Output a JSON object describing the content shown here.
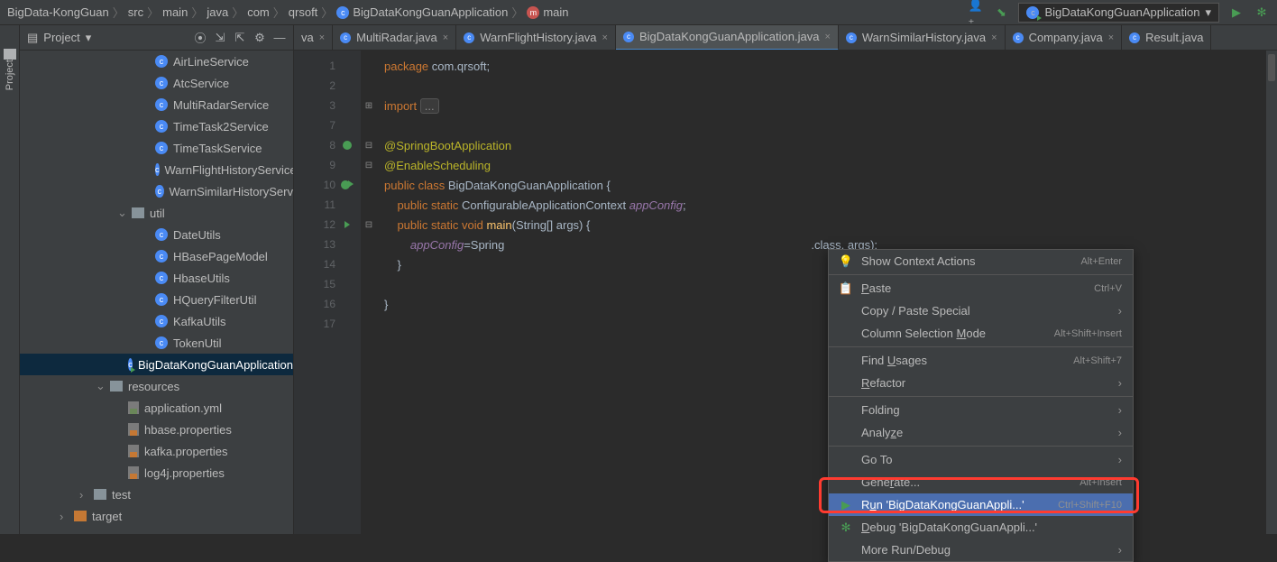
{
  "breadcrumbs": [
    "BigData-KongGuan",
    "src",
    "main",
    "java",
    "com",
    "qrsoft",
    "BigDataKongGuanApplication",
    "main"
  ],
  "run_config": "BigDataKongGuanApplication",
  "leftrail": "Project",
  "projpanel_title": "Project",
  "tree": {
    "services": [
      "AirLineService",
      "AtcService",
      "MultiRadarService",
      "TimeTask2Service",
      "TimeTaskService",
      "WarnFlightHistoryService",
      "WarnSimilarHistoryServ"
    ],
    "util_label": "util",
    "utils": [
      "DateUtils",
      "HBasePageModel",
      "HbaseUtils",
      "HQueryFilterUtil",
      "KafkaUtils",
      "TokenUtil"
    ],
    "app_class": "BigDataKongGuanApplication",
    "resources_label": "resources",
    "resources": [
      "application.yml",
      "hbase.properties",
      "kafka.properties",
      "log4j.properties"
    ],
    "test_label": "test",
    "target_label": "target"
  },
  "tabs": [
    {
      "label": "va",
      "active": false,
      "partial": true
    },
    {
      "label": "MultiRadar.java",
      "active": false
    },
    {
      "label": "WarnFlightHistory.java",
      "active": false
    },
    {
      "label": "BigDataKongGuanApplication.java",
      "active": true
    },
    {
      "label": "WarnSimilarHistory.java",
      "active": false
    },
    {
      "label": "Company.java",
      "active": false
    },
    {
      "label": "Result.java",
      "active": false,
      "noclose": true
    }
  ],
  "line_numbers": [
    "1",
    "2",
    "3",
    "7",
    "8",
    "9",
    "10",
    "11",
    "12",
    "13",
    "14",
    "15",
    "16",
    "17"
  ],
  "code": {
    "l1_kw": "package ",
    "l1_rest": "com.qrsoft;",
    "l3_kw": "import ",
    "l3_fold": "...",
    "l5": "@SpringBootApplication",
    "l6": "@EnableScheduling",
    "l7_kw": "public class ",
    "l7_name": "BigDataKongGuanApplication ",
    "l7_brace": "{",
    "l8_indent": "    ",
    "l8_kw": "public static ",
    "l8_type": "ConfigurableApplicationContext ",
    "l8_field": "appConfig",
    "l8_semi": ";",
    "l9_indent": "    ",
    "l9_kw": "public static void ",
    "l9_fn": "main",
    "l9_args": "(String[] args) {",
    "l10_indent": "        ",
    "l10_field": "appConfig",
    "l10_eq": "=Spring",
    "l10_tail": ".class, args);",
    "l11": "    }",
    "l13": "}"
  },
  "ctx": [
    {
      "type": "item",
      "icon": "bulb",
      "label": "Show Context Actions",
      "shortcut": "Alt+Enter"
    },
    {
      "type": "sep"
    },
    {
      "type": "item",
      "icon": "paste",
      "label_pre": "",
      "u": "P",
      "label_post": "aste",
      "shortcut": "Ctrl+V"
    },
    {
      "type": "item",
      "label": "Copy / Paste Special",
      "submenu": true
    },
    {
      "type": "item",
      "label_pre": "Column Selection ",
      "u": "M",
      "label_post": "ode",
      "shortcut": "Alt+Shift+Insert"
    },
    {
      "type": "sep"
    },
    {
      "type": "item",
      "label_pre": "Find ",
      "u": "U",
      "label_post": "sages",
      "shortcut": "Alt+Shift+7"
    },
    {
      "type": "item",
      "u": "R",
      "label_post": "efactor",
      "submenu": true
    },
    {
      "type": "sep"
    },
    {
      "type": "item",
      "label": "Folding",
      "submenu": true
    },
    {
      "type": "item",
      "label_pre": "Analy",
      "u": "z",
      "label_post": "e",
      "submenu": true
    },
    {
      "type": "sep"
    },
    {
      "type": "item",
      "label": "Go To",
      "submenu": true
    },
    {
      "type": "item",
      "label_pre": "Gene",
      "u": "r",
      "label_post": "ate...",
      "shortcut": "Alt+Insert"
    },
    {
      "type": "item",
      "icon": "play",
      "label_pre": "R",
      "u": "u",
      "label_post": "n 'BigDataKongGuanAppli...'",
      "shortcut": "Ctrl+Shift+F10",
      "selected": true
    },
    {
      "type": "item",
      "icon": "bug",
      "label_pre": "",
      "u": "D",
      "label_post": "ebug 'BigDataKongGuanAppli...'"
    },
    {
      "type": "item",
      "label": "More Run/Debug",
      "submenu": true
    }
  ]
}
